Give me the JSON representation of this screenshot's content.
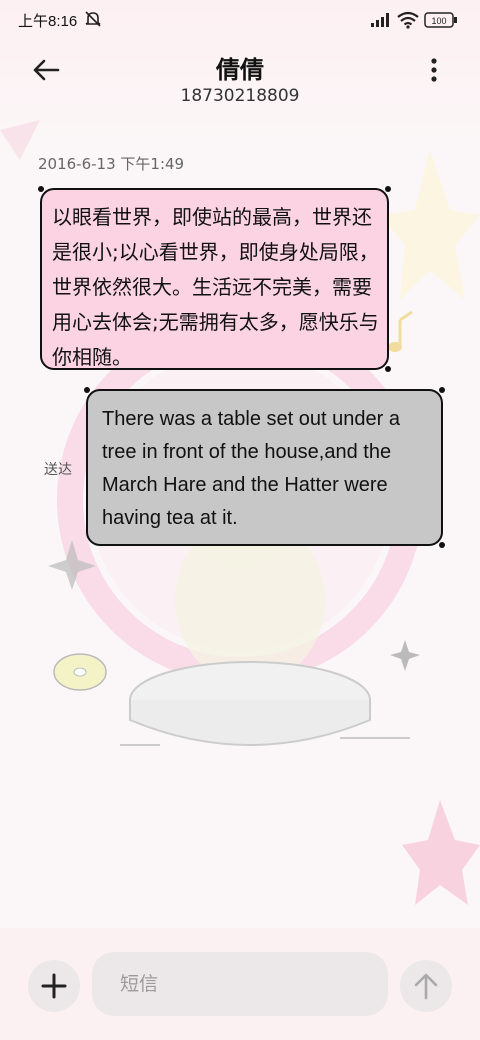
{
  "status_bar": {
    "time": "上午8:16",
    "battery": "100",
    "icons": [
      "mute-bell-icon",
      "signal-icon",
      "wifi-icon",
      "battery-icon"
    ]
  },
  "header": {
    "contact_name": "倩倩",
    "contact_number": "18730218809",
    "back_icon": "back-arrow-icon",
    "more_icon": "more-vertical-icon"
  },
  "conversation": {
    "timestamp": "2016-6-13 下午1:49",
    "messages": [
      {
        "direction": "incoming",
        "text": "以眼看世界，即使站的最高，世界还是很小;以心看世界，即使身处局限，世界依然很大。生活远不完美，需要用心去体会;无需拥有太多，愿快乐与你相随。"
      },
      {
        "direction": "outgoing",
        "text": "There was a table set out under a tree in front of the house,and the March Hare and the Hatter were having tea at it.",
        "status": "送达"
      }
    ]
  },
  "compose": {
    "placeholder": "短信",
    "add_icon": "plus-icon",
    "send_icon": "send-arrow-icon"
  },
  "colors": {
    "incoming_bubble": "#fbd3e3",
    "outgoing_bubble": "#c7c7c7",
    "background": "#fbf7f8"
  }
}
